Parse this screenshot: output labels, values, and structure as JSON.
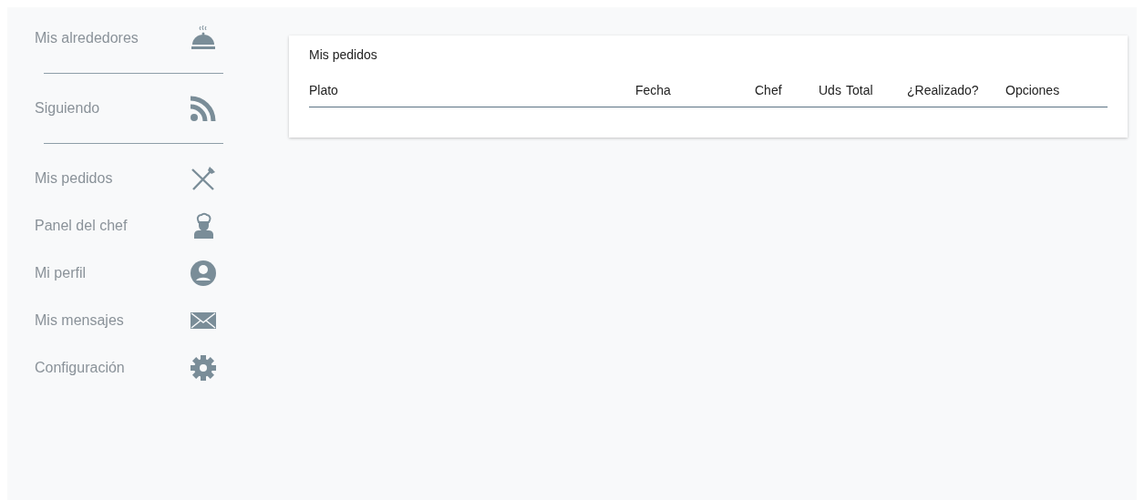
{
  "sidebar": {
    "items": [
      {
        "label": "Mis alrededores",
        "divider_below": true
      },
      {
        "label": "Siguiendo",
        "divider_below": true
      },
      {
        "label": "Mis pedidos",
        "divider_below": false
      },
      {
        "label": "Panel del chef",
        "divider_below": false
      },
      {
        "label": "Mi perfil",
        "divider_below": false
      },
      {
        "label": "Mis mensajes",
        "divider_below": false
      },
      {
        "label": "Configuración",
        "divider_below": false
      }
    ]
  },
  "orders_card": {
    "title": "Mis pedidos",
    "table": {
      "columns": [
        "Plato",
        "Fecha",
        "Chef",
        "Uds",
        "Total",
        "¿Realizado?",
        "Opciones"
      ]
    }
  }
}
